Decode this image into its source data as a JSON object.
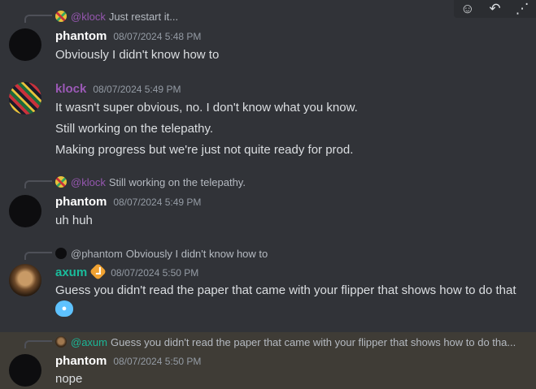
{
  "toolbar": {
    "icons": [
      "add-reaction-icon",
      "reply-icon",
      "more-icon"
    ]
  },
  "colors": {
    "phantom": "#ffffff",
    "klock": "#9b59b6",
    "axum": "#1abc9c",
    "timestamp": "#949ba4",
    "highlight": "#3f3c36"
  },
  "messages": [
    {
      "reply": {
        "author": "@klock",
        "text": "Just restart it..."
      },
      "author": "phantom",
      "timestamp": "08/07/2024 5:48 PM",
      "lines": [
        "Obviously I didn't know how to"
      ]
    },
    {
      "author": "klock",
      "timestamp": "08/07/2024 5:49 PM",
      "lines": [
        "It wasn't super obvious, no. I don't know what you know.",
        "Still working on the telepathy.",
        "Making progress but we're just not quite ready for prod."
      ]
    },
    {
      "reply": {
        "author": "@klock",
        "text": "Still working on the telepathy."
      },
      "author": "phantom",
      "timestamp": "08/07/2024 5:49 PM",
      "lines": [
        "uh huh"
      ]
    },
    {
      "reply": {
        "author": "@phantom",
        "text": "Obviously I didn't know how to"
      },
      "author": "axum",
      "timestamp": "08/07/2024 5:50 PM",
      "lines": [
        "Guess you didn't read the paper that came with your flipper that shows how to do that"
      ],
      "emoji": "flipper-emoji"
    },
    {
      "reply": {
        "author": "@axum",
        "text": "Guess you didn't read the paper that came with your flipper that shows how to do tha..."
      },
      "author": "phantom",
      "timestamp": "08/07/2024 5:50 PM",
      "lines": [
        "nope"
      ]
    }
  ]
}
